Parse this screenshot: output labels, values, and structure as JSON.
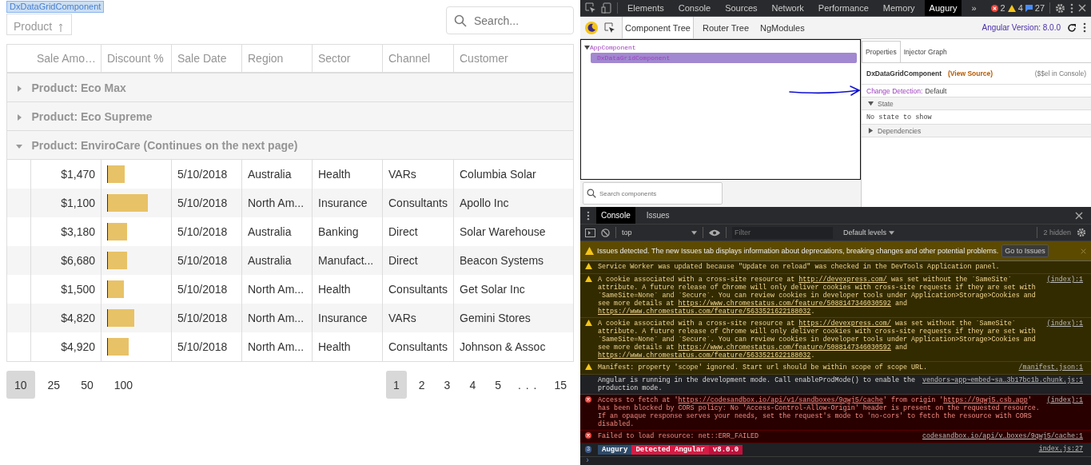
{
  "grid": {
    "highlight_label": "DxDataGridComponent",
    "group_panel": {
      "label": "Product"
    },
    "search": {
      "placeholder": "Search..."
    },
    "columns": [
      "Sale Amo…",
      "Discount %",
      "Sale Date",
      "Region",
      "Sector",
      "Channel",
      "Customer"
    ],
    "groups": [
      {
        "label": "Product: Eco Max",
        "expanded": false
      },
      {
        "label": "Product: Eco Supreme",
        "expanded": false
      },
      {
        "label": "Product: EnviroCare (Continues on the next page)",
        "expanded": true
      }
    ],
    "rows": [
      {
        "amount": "$1,470",
        "level": 0.29,
        "date": "5/10/2018",
        "region": "Australia",
        "sector": "Health",
        "channel": "VARs",
        "customer": "Columbia Solar"
      },
      {
        "amount": "$1,100",
        "level": 0.69,
        "date": "5/10/2018",
        "region": "North Am...",
        "sector": "Insurance",
        "channel": "Consultants",
        "customer": "Apollo Inc"
      },
      {
        "amount": "$3,180",
        "level": 0.33,
        "date": "5/10/2018",
        "region": "Australia",
        "sector": "Banking",
        "channel": "Direct",
        "customer": "Solar Warehouse"
      },
      {
        "amount": "$6,680",
        "level": 0.33,
        "date": "5/10/2018",
        "region": "Australia",
        "sector": "Manufact...",
        "channel": "Direct",
        "customer": "Beacon Systems"
      },
      {
        "amount": "$1,500",
        "level": 0.27,
        "date": "5/10/2018",
        "region": "North Am...",
        "sector": "Health",
        "channel": "Consultants",
        "customer": "Get Solar Inc"
      },
      {
        "amount": "$4,820",
        "level": 0.45,
        "date": "5/10/2018",
        "region": "North Am...",
        "sector": "Insurance",
        "channel": "VARs",
        "customer": "Gemini Stores"
      },
      {
        "amount": "$4,920",
        "level": 0.35,
        "date": "5/10/2018",
        "region": "North Am...",
        "sector": "Health",
        "channel": "Consultants",
        "customer": "Johnson & Assoc"
      }
    ],
    "pager": {
      "sizes": [
        {
          "label": "10",
          "selected": true
        },
        {
          "label": "25",
          "selected": false
        },
        {
          "label": "50",
          "selected": false
        },
        {
          "label": "100",
          "selected": false
        }
      ],
      "pages": [
        {
          "kind": "page",
          "label": "1",
          "selected": true
        },
        {
          "kind": "page",
          "label": "2",
          "selected": false
        },
        {
          "kind": "page",
          "label": "3",
          "selected": false
        },
        {
          "kind": "page",
          "label": "4",
          "selected": false
        },
        {
          "kind": "page",
          "label": "5",
          "selected": false
        },
        {
          "kind": "gap",
          "label": ". . ."
        },
        {
          "kind": "page",
          "label": "15",
          "selected": false
        }
      ]
    }
  },
  "devtools": {
    "tabs": [
      {
        "label": "Elements",
        "selected": false
      },
      {
        "label": "Console",
        "selected": false
      },
      {
        "label": "Sources",
        "selected": false
      },
      {
        "label": "Network",
        "selected": false
      },
      {
        "label": "Performance",
        "selected": false
      },
      {
        "label": "Memory",
        "selected": false
      },
      {
        "label": "Augury",
        "selected": true
      }
    ],
    "more_tabs": "»",
    "counts": {
      "errors": "2",
      "warnings": "4",
      "messages": "27"
    },
    "augury": {
      "tabs": [
        {
          "label": "Component Tree",
          "selected": true
        },
        {
          "label": "Router Tree",
          "selected": false
        },
        {
          "label": "NgModules",
          "selected": false
        }
      ],
      "version": "Angular Version: 8.0.0",
      "tree": [
        {
          "label": "AppComponent",
          "expanded": true,
          "selected": false,
          "children": [
            {
              "label": "DxDataGridComponent",
              "selected": true
            }
          ]
        }
      ],
      "search": {
        "placeholder": "Search components"
      },
      "properties": {
        "tabs": [
          {
            "label": "Properties",
            "selected": true
          },
          {
            "label": "Injector Graph",
            "selected": false
          }
        ],
        "component": "DxDataGridComponent",
        "view_source": "(View Source)",
        "console_ref": "($$el in Console)",
        "change_detection_label": "Change Detection:",
        "change_detection_value": "Default",
        "sections": [
          {
            "label": "State",
            "expanded": true,
            "body": "No state to show"
          },
          {
            "label": "Dependencies",
            "expanded": false
          }
        ]
      }
    },
    "console": {
      "tabs": [
        {
          "label": "Console",
          "selected": true
        },
        {
          "label": "Issues",
          "selected": false
        }
      ],
      "context": "top",
      "filter_placeholder": "Filter",
      "levels": "Default levels",
      "hidden": "2 hidden",
      "issues_banner": "Issues detected. The new Issues tab displays information about deprecations, breaking changes and other potential problems.",
      "issues_button": "Go to Issues",
      "messages": [
        {
          "kind": "warning",
          "parts": [
            {
              "text": "Service Worker was updated because \"Update on reload\" was checked in the DevTools Application panel."
            }
          ]
        },
        {
          "kind": "warning",
          "source": "(index):1",
          "parts": [
            {
              "text": "A cookie associated with a cross-site resource at "
            },
            {
              "text": "http://devexpress.com/",
              "kind": "link"
            },
            {
              "text": " was set without the `SameSite` attribute. A future release of Chrome will only deliver cookies with cross-site requests if they are set with `SameSite=None` and `Secure`. You can review cookies in developer tools under Application>Storage>Cookies and see more details at "
            },
            {
              "text": "https://www.chromestatus.com/feature/5088147346030592",
              "kind": "link"
            },
            {
              "text": " and "
            },
            {
              "text": "https://www.chromestatus.com/feature/5633521622188032",
              "kind": "link"
            },
            {
              "text": "."
            }
          ]
        },
        {
          "kind": "warning",
          "source": "(index):1",
          "parts": [
            {
              "text": "A cookie associated with a cross-site resource at "
            },
            {
              "text": "https://devexpress.com/",
              "kind": "link"
            },
            {
              "text": " was set without the `SameSite` attribute. A future release of Chrome will only deliver cookies with cross-site requests if they are set with `SameSite=None` and `Secure`. You can review cookies in developer tools under Application>Storage>Cookies and see more details at "
            },
            {
              "text": "https://www.chromestatus.com/feature/5088147346030592",
              "kind": "link"
            },
            {
              "text": " and "
            },
            {
              "text": "https://www.chromestatus.com/feature/5633521622188032",
              "kind": "link"
            },
            {
              "text": "."
            }
          ]
        },
        {
          "kind": "warning",
          "source": "/manifest.json:1",
          "parts": [
            {
              "text": "Manifest: property 'scope' ignored. Start url should be within scope of scope URL."
            }
          ]
        },
        {
          "kind": "info",
          "source": "vendors~app~embed~sa…3b17bc1b.chunk.js:1",
          "parts": [
            {
              "text": "Angular is running in the development mode. Call enableProdMode() to enable the production mode."
            }
          ]
        },
        {
          "kind": "error",
          "source": "(index):1",
          "parts": [
            {
              "text": "Access to fetch at '"
            },
            {
              "text": "https://codesandbox.io/api/v1/sandboxes/9qwj5/cache",
              "kind": "link"
            },
            {
              "text": "' from origin '"
            },
            {
              "text": "https://9qwj5.csb.app",
              "kind": "link"
            },
            {
              "text": "' has been blocked by CORS policy: No 'Access-Control-Allow-Origin' header is present on the requested resource. If an opaque response serves your needs, set the request's mode to 'no-cors' to fetch the resource with CORS disabled."
            }
          ]
        },
        {
          "kind": "error",
          "source": "codesandbox.io/api/v…boxes/9qwj5/cache:1",
          "parts": [
            {
              "text": "Failed to load resource: net::ERR_FAILED"
            }
          ]
        }
      ],
      "augury_line": {
        "count": "3",
        "badges": [
          "Augury",
          "Detected Angular",
          "v8.0.0"
        ],
        "source": "index.js:27"
      },
      "prompt": "›"
    }
  }
}
